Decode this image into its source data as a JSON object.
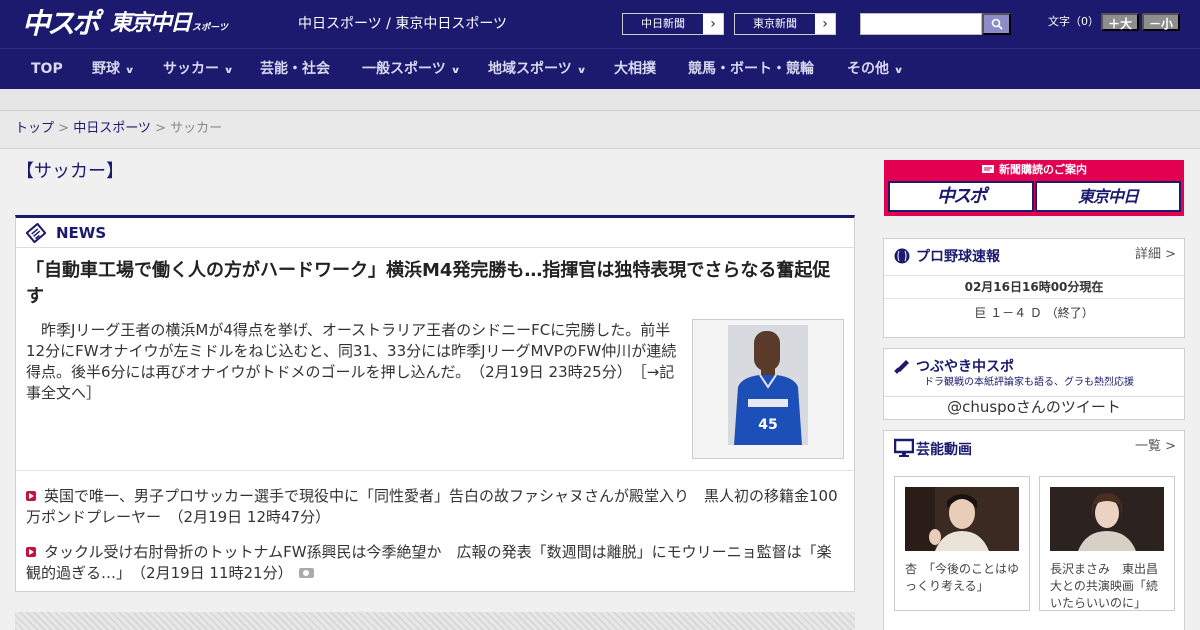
{
  "header": {
    "logo_chuspo": "中スポ",
    "logo_tokyo": "東京中日",
    "logo_tokyo_sub": "スポーツ",
    "site_links": "中日スポーツ / 東京中日スポーツ",
    "paper_btn_1": "中日新聞",
    "paper_btn_2": "東京新聞",
    "search_placeholder": "",
    "font_size_label": "文字（0）",
    "font_up": "＋大",
    "font_down": "－小"
  },
  "nav": {
    "items": [
      {
        "label": "TOP"
      },
      {
        "label": "野球"
      },
      {
        "label": "サッカー"
      },
      {
        "label": "芸能・社会"
      },
      {
        "label": "一般スポーツ"
      },
      {
        "label": "地域スポーツ"
      },
      {
        "label": "大相撲"
      },
      {
        "label": "競馬・ボート・競輪"
      },
      {
        "label": "その他"
      }
    ],
    "chevron": "∨"
  },
  "breadcrumb": {
    "top": "トップ",
    "sep": " > ",
    "parent": "中日スポーツ",
    "current": "サッカー"
  },
  "section_title": "【サッカー】",
  "news": {
    "header": "NEWS",
    "lead": {
      "title": "「自動車工場で働く人の方がハードワーク」横浜M4発完勝も…指揮官は独特表現でさらなる奮起促す",
      "body": "昨季Jリーグ王者の横浜Mが4得点を挙げ、オーストラリア王者のシドニーFCに完勝した。前半12分にFWオナイウが左ミドルをねじ込むと、同31、33分には昨季JリーグMVPのFW仲川が連続得点。後半6分には再びオナイウがトドメのゴールを押し込んだ。",
      "time": "（2月19日 23時25分）",
      "more": "［→記事全文へ］",
      "photo_number": "45"
    },
    "items": [
      {
        "title": "英国で唯一、男子プロサッカー選手で現役中に「同性愛者」告白の故ファシャヌさんが殿堂入り　黒人初の移籍金100万ポンドプレーヤー",
        "time": "（2月19日 12時47分）"
      },
      {
        "title": "タックル受け右肘骨折のトットナムFW孫興民は今季絶望か　広報の発表「数週間は離脱」にモウリーニョ監督は「楽観的過ぎる…」",
        "time": "（2月19日 11時21分）"
      }
    ]
  },
  "sidebar": {
    "subscription": {
      "title": "新聞購読のご案内",
      "chuspo": "中スポ",
      "tokyo": "東京中日"
    },
    "baseball": {
      "title": "プロ野球速報",
      "link": "詳細 >",
      "time": "02月16日16時00分現在",
      "game": "巨 １－４ Ｄ （終了）"
    },
    "twitter": {
      "title": "つぶやき中スポ",
      "subtitle": "ドラ観戦の本紙評論家も語る、グラも熱烈応援",
      "handle": "@chuspoさんのツイート"
    },
    "videos": {
      "title": "芸能動画",
      "link": "一覧 >",
      "items": [
        {
          "caption": "杏　「今後のことはゆっくり考える」"
        },
        {
          "caption": "長沢まさみ　東出昌大との共演映画「続いたらいいのに」"
        }
      ]
    }
  },
  "colors": {
    "brand_navy": "#1b1a6f",
    "accent_red": "#e3004f",
    "marker_red": "#c0143c"
  }
}
